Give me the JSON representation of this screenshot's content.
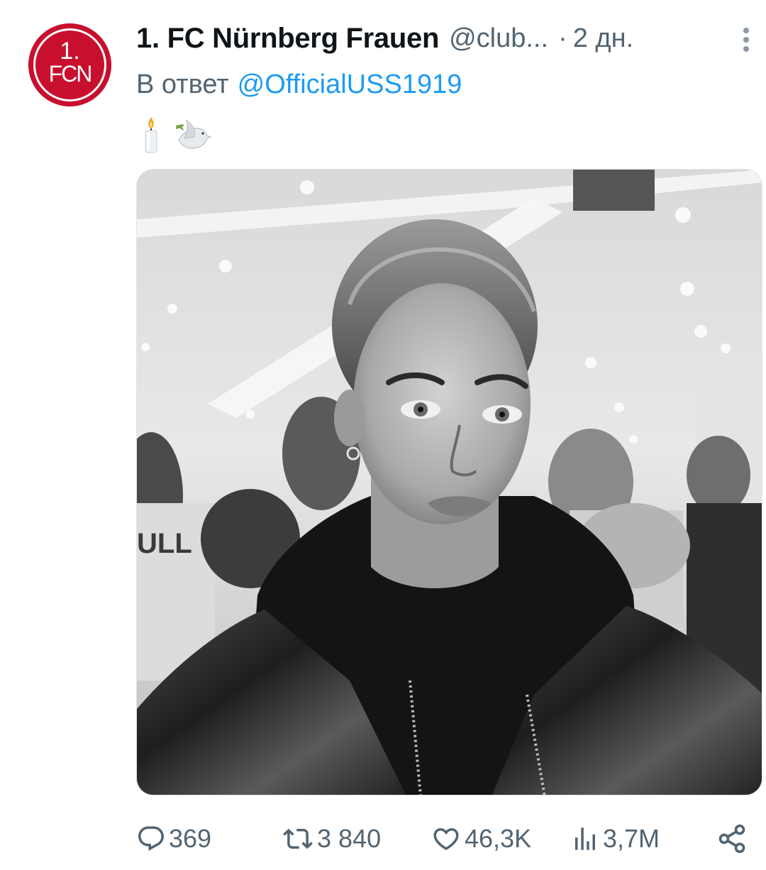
{
  "tweet": {
    "author": {
      "display_name": "1. FC Nürnberg Frauen",
      "handle": "@club...",
      "avatar_text_top": "1.",
      "avatar_text_bottom": "FCN",
      "avatar_color": "#c8102e"
    },
    "separator": "·",
    "time": "2 дн.",
    "reply_prefix": "В ответ",
    "reply_to": "@OfficialUSS1919",
    "emojis": [
      "candle-emoji",
      "dove-emoji"
    ],
    "media": {
      "kind": "photo",
      "style": "black-and-white portrait"
    }
  },
  "actions": {
    "replies": "369",
    "reposts": "3 840",
    "likes": "46,3K",
    "views": "3,7M"
  },
  "colors": {
    "text_primary": "#0f1419",
    "text_secondary": "#536471",
    "link": "#1d9bf0"
  },
  "icons": {
    "more": "more-vertical-icon",
    "reply": "reply-icon",
    "repost": "repost-icon",
    "like": "heart-icon",
    "views": "views-icon",
    "share": "share-icon"
  }
}
